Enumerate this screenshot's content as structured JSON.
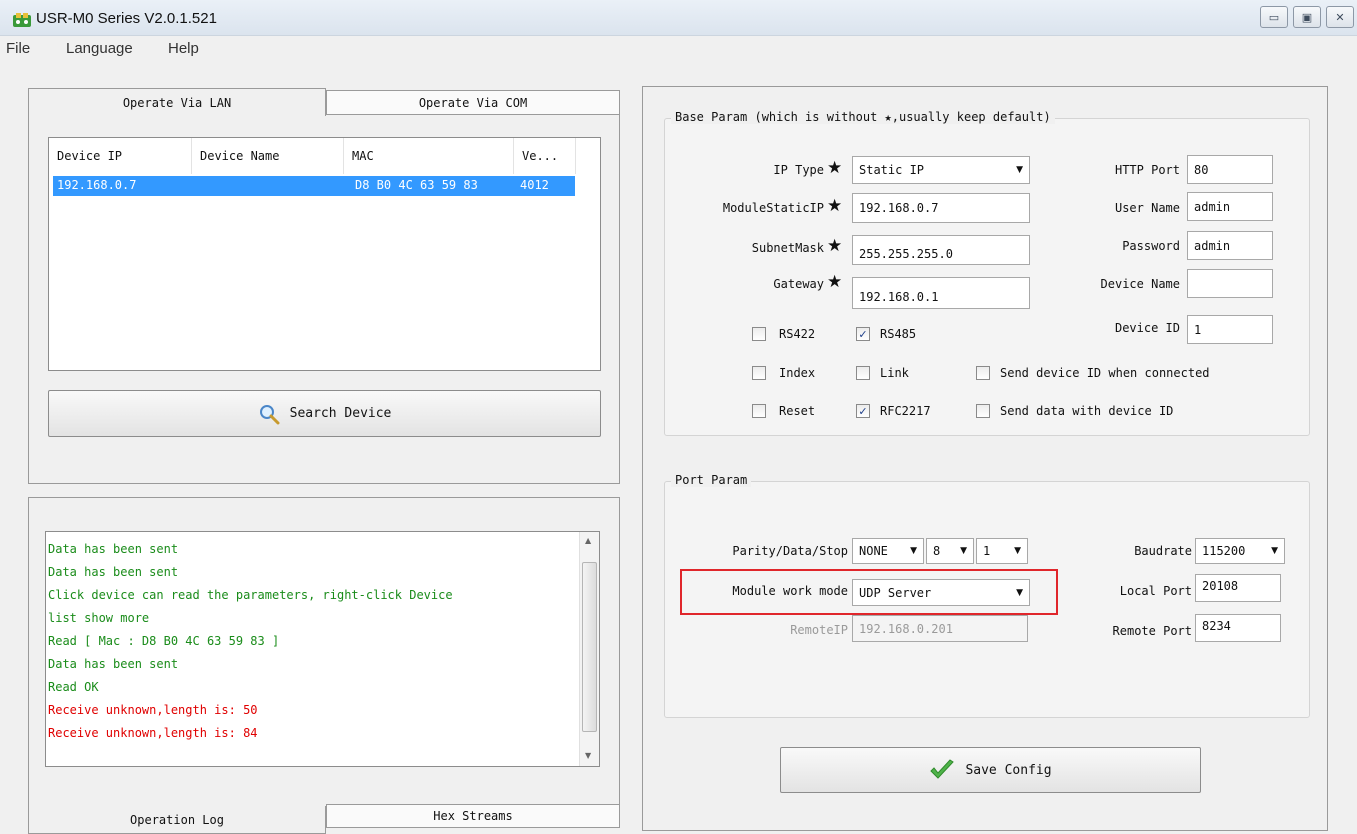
{
  "window": {
    "title": "USR-M0 Series V2.0.1.521",
    "min_glyph": "▭",
    "max_glyph": "▣",
    "close_glyph": "✕"
  },
  "menu": [
    "File",
    "Language",
    "Help"
  ],
  "left_tabs": [
    "Operate Via LAN",
    "Operate Via COM"
  ],
  "device_list": {
    "columns": [
      "Device IP",
      "Device Name",
      "MAC",
      "Ve..."
    ],
    "rows": [
      {
        "ip": "192.168.0.7",
        "name": "",
        "mac": "D8 B0 4C 63 59 83",
        "version": "4012"
      }
    ]
  },
  "search_button": "Search Device",
  "log": {
    "lines": [
      {
        "text": " Data has been sent",
        "color": "green"
      },
      {
        "text": " Data has been sent",
        "color": "green"
      },
      {
        "text": "Click device can read the parameters, right-click Device",
        "color": "green"
      },
      {
        "text": "list show more",
        "color": "green"
      },
      {
        "text": "Read [ Mac : D8 B0 4C 63 59 83 ]",
        "color": "green"
      },
      {
        "text": " Data has been sent",
        "color": "green"
      },
      {
        "text": "Read OK",
        "color": "green"
      },
      {
        "text": " Receive unknown,length is: 50",
        "color": "red"
      },
      {
        "text": " Receive unknown,length is: 84",
        "color": "red"
      }
    ]
  },
  "bottom_tabs": [
    "Operation Log",
    "Hex Streams"
  ],
  "base_param": {
    "legend": "Base Param (which is without ★,usually keep default)",
    "star": "★",
    "ip_type_label": "IP Type",
    "ip_type_value": "Static IP",
    "module_ip_label": "ModuleStaticIP",
    "module_ip_value": "192.168.0.7",
    "subnet_label": "SubnetMask",
    "subnet_value": "255.255.255.0",
    "gateway_label": "Gateway",
    "gateway_value": "192.168.0.1",
    "http_port_label": "HTTP Port",
    "http_port_value": "80",
    "user_name_label": "User Name",
    "user_name_value": "admin",
    "password_label": "Password",
    "password_value": "admin",
    "device_name_label": "Device Name",
    "device_name_value": "",
    "device_id_label": "Device ID",
    "device_id_value": "1",
    "checkboxes": {
      "rs422": {
        "label": "RS422",
        "checked": false
      },
      "rs485": {
        "label": "RS485",
        "checked": true
      },
      "index": {
        "label": "Index",
        "checked": false
      },
      "link": {
        "label": "Link",
        "checked": false
      },
      "send_id": {
        "label": "Send device ID when connected",
        "checked": false
      },
      "reset": {
        "label": "Reset",
        "checked": false
      },
      "rfc2217": {
        "label": "RFC2217",
        "checked": true
      },
      "send_data_id": {
        "label": "Send data with device ID",
        "checked": false
      }
    }
  },
  "port_param": {
    "legend": "Port Param",
    "pds_label": "Parity/Data/Stop",
    "parity": "NONE",
    "data_bits": "8",
    "stop_bits": "1",
    "work_mode_label": "Module work mode",
    "work_mode": "UDP Server",
    "remote_ip_label": "RemoteIP",
    "remote_ip": "192.168.0.201",
    "baudrate_label": "Baudrate",
    "baudrate": "115200",
    "local_port_label": "Local Port",
    "local_port": "20108",
    "remote_port_label": "Remote Port",
    "remote_port": "8234"
  },
  "save_button": "Save Config",
  "colors": {
    "selection": "#3399ff",
    "log_green": "#1a8c1a",
    "log_red": "#e00000",
    "highlight_box": "#e0262b"
  }
}
